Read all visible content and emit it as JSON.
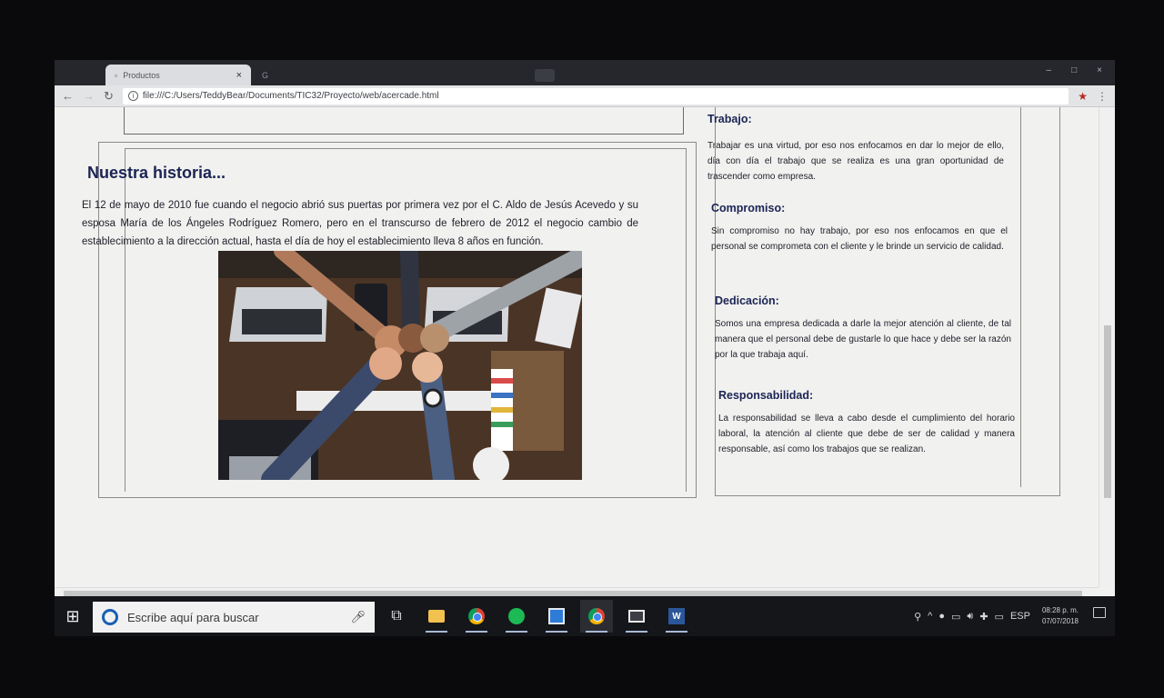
{
  "browser": {
    "tabs": [
      {
        "title": "Productos",
        "active": true
      },
      {
        "title": "",
        "active": false
      },
      {
        "title": "",
        "active": false
      }
    ],
    "url": "file:///C:/Users/TeddyBear/Documents/TIC32/Proyecto/web/acercade.html"
  },
  "historia": {
    "title": "Nuestra historia...",
    "text": "El 12 de mayo de 2010 fue cuando el negocio abrió sus puertas por primera vez por el C. Aldo de Jesús Acevedo y su esposa María de los Ángeles Rodríguez Romero, pero en el transcurso de febrero de 2012 el negocio cambio de establecimiento a la dirección actual, hasta el día de hoy el establecimiento lleva 8 años en función."
  },
  "values": [
    {
      "title": "Trabajo:",
      "text": "Trabajar es una virtud, por eso nos enfocamos en dar lo mejor de ello, día con día el trabajo que se realiza es una gran oportunidad de trascender como empresa."
    },
    {
      "title": "Compromiso:",
      "text": "Sin compromiso no hay trabajo, por eso nos enfocamos en que el personal se comprometa con el cliente y le brinde un servicio de calidad."
    },
    {
      "title": "Dedicación:",
      "text": "Somos una empresa dedicada a darle la mejor atención al cliente, de tal manera que el personal debe de gustarle lo que hace y debe ser la razón por la que trabaja aquí."
    },
    {
      "title": "Responsabilidad:",
      "text": "La responsabilidad se lleva a cabo desde el cumplimiento del horario laboral, la atención al cliente que debe de ser de calidad y manera responsable, así como los trabajos que se realizan."
    }
  ],
  "taskbar": {
    "search_placeholder": "Escribe aquí para buscar",
    "language": "ESP",
    "time": "08:28 p. m.",
    "date": "07/07/2018",
    "apps": [
      "task-view",
      "file-explorer",
      "chrome",
      "spotify",
      "blue-app",
      "chrome",
      "photos",
      "word"
    ]
  }
}
